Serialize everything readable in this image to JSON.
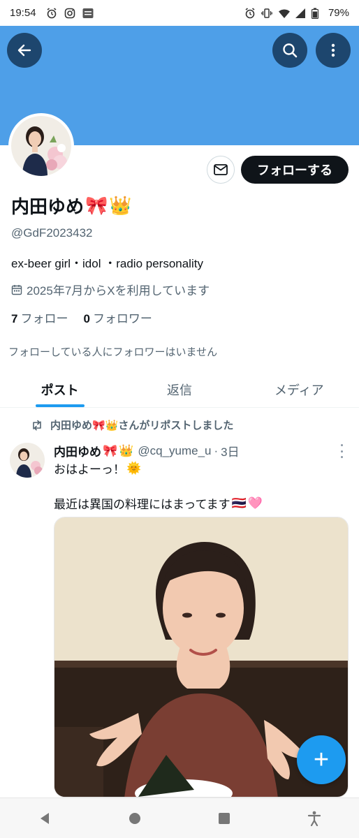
{
  "status_bar": {
    "time": "19:54",
    "battery": "79%",
    "icons_left": [
      "alarm-icon",
      "instagram-icon",
      "showroom-icon"
    ],
    "icons_right": [
      "alarm-icon",
      "vibrate-icon",
      "wifi-icon",
      "signal-icon",
      "battery-icon"
    ]
  },
  "profile": {
    "name": "内田ゆめ",
    "name_emojis": [
      "🎀",
      "👑"
    ],
    "handle": "@GdF2023432",
    "bio": "ex-beer girl・idol ・radio personality",
    "joined": "2025年7月からXを利用しています",
    "following_count": "7",
    "following_label": "フォロー",
    "followers_count": "0",
    "followers_label": "フォロワー",
    "not_followed_text": "フォローしている人にフォロワーはいません",
    "follow_button": "フォローする"
  },
  "tabs": [
    {
      "label": "ポスト",
      "active": true
    },
    {
      "label": "返信",
      "active": false
    },
    {
      "label": "メディア",
      "active": false
    }
  ],
  "post": {
    "repost_text": "内田ゆめ🎀👑さんがリポストしました",
    "author_name": "内田ゆめ",
    "author_handle": "@cq_yume_u",
    "time_ago": "3日",
    "separator": "·",
    "line1": "おはよーっ！",
    "line1_emoji": "🌞",
    "line2": "最近は異国の料理にはまってます",
    "line2_emojis": [
      "🇹🇭",
      "🩷"
    ]
  },
  "fab": {
    "label": "+"
  },
  "colors": {
    "banner": "#4e9fe8",
    "accent": "#1d9bf0",
    "text": "#0f1419",
    "muted": "#536471"
  }
}
